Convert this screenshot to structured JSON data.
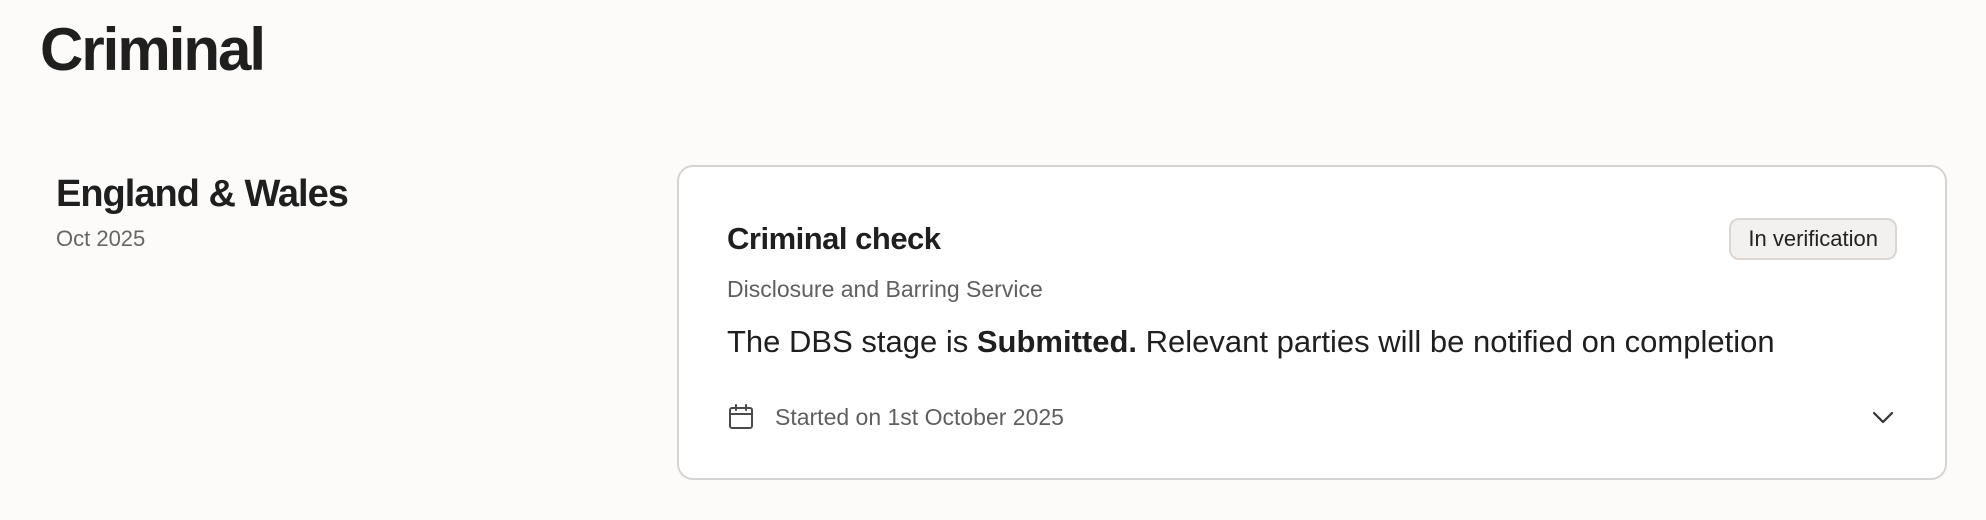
{
  "page": {
    "title": "Criminal"
  },
  "region": {
    "name": "England & Wales",
    "date": "Oct 2025"
  },
  "check": {
    "title": "Criminal check",
    "status": "In verification",
    "provider": "Disclosure and Barring Service",
    "message_prefix": "The DBS stage is ",
    "message_stage": "Submitted.",
    "message_suffix": " Relevant parties will be notified on completion",
    "started": "Started on 1st October 2025",
    "icons": {
      "calendar": "calendar-icon",
      "expand": "chevron-down-icon"
    }
  }
}
